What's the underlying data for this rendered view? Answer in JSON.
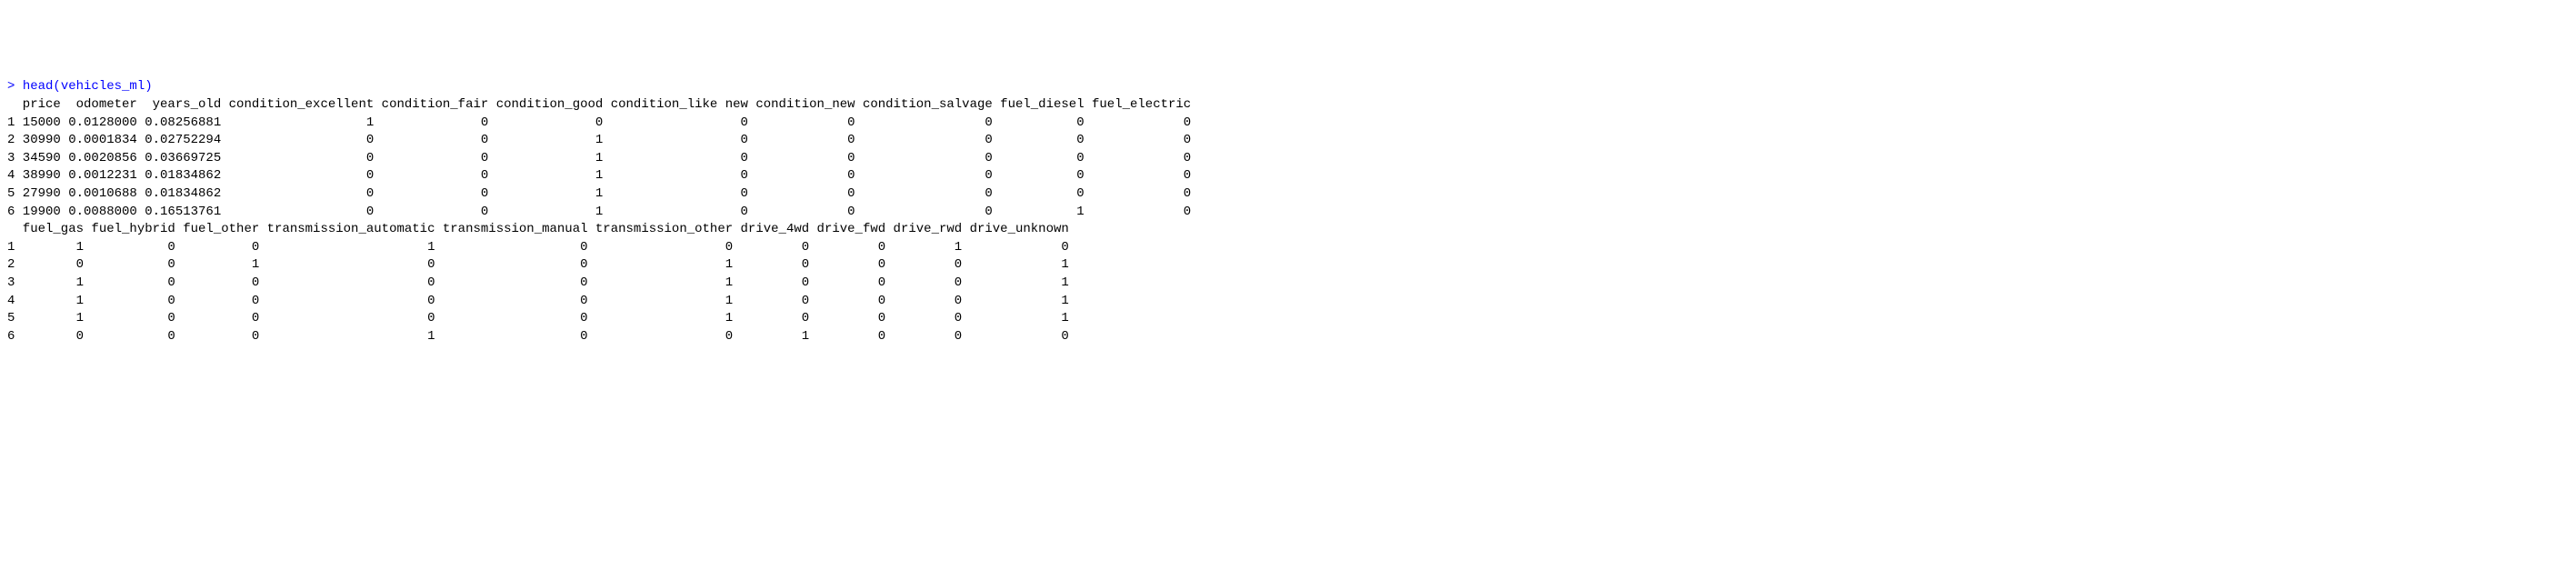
{
  "prompt": "> ",
  "command": "head(vehicles_ml)",
  "table1": {
    "header": "  price  odometer  years_old condition_excellent condition_fair condition_good condition_like new condition_new condition_salvage fuel_diesel fuel_electric",
    "rows": [
      "1 15000 0.0128000 0.08256881                   1              0              0                  0             0                 0           0             0",
      "2 30990 0.0001834 0.02752294                   0              0              1                  0             0                 0           0             0",
      "3 34590 0.0020856 0.03669725                   0              0              1                  0             0                 0           0             0",
      "4 38990 0.0012231 0.01834862                   0              0              1                  0             0                 0           0             0",
      "5 27990 0.0010688 0.01834862                   0              0              1                  0             0                 0           0             0",
      "6 19900 0.0088000 0.16513761                   0              0              1                  0             0                 0           1             0"
    ]
  },
  "table2": {
    "header": "  fuel_gas fuel_hybrid fuel_other transmission_automatic transmission_manual transmission_other drive_4wd drive_fwd drive_rwd drive_unknown",
    "rows": [
      "1        1           0          0                      1                   0                  0         0         0         1             0",
      "2        0           0          1                      0                   0                  1         0         0         0             1",
      "3        1           0          0                      0                   0                  1         0         0         0             1",
      "4        1           0          0                      0                   0                  1         0         0         0             1",
      "5        1           0          0                      0                   0                  1         0         0         0             1",
      "6        0           0          0                      1                   0                  0         1         0         0             0"
    ]
  },
  "chart_data": {
    "type": "table",
    "title": "head(vehicles_ml)",
    "columns_part1": [
      "price",
      "odometer",
      "years_old",
      "condition_excellent",
      "condition_fair",
      "condition_good",
      "condition_like new",
      "condition_new",
      "condition_salvage",
      "fuel_diesel",
      "fuel_electric"
    ],
    "columns_part2": [
      "fuel_gas",
      "fuel_hybrid",
      "fuel_other",
      "transmission_automatic",
      "transmission_manual",
      "transmission_other",
      "drive_4wd",
      "drive_fwd",
      "drive_rwd",
      "drive_unknown"
    ],
    "data": [
      {
        "row": 1,
        "price": 15000,
        "odometer": 0.0128,
        "years_old": 0.08256881,
        "condition_excellent": 1,
        "condition_fair": 0,
        "condition_good": 0,
        "condition_like_new": 0,
        "condition_new": 0,
        "condition_salvage": 0,
        "fuel_diesel": 0,
        "fuel_electric": 0,
        "fuel_gas": 1,
        "fuel_hybrid": 0,
        "fuel_other": 0,
        "transmission_automatic": 1,
        "transmission_manual": 0,
        "transmission_other": 0,
        "drive_4wd": 0,
        "drive_fwd": 0,
        "drive_rwd": 1,
        "drive_unknown": 0
      },
      {
        "row": 2,
        "price": 30990,
        "odometer": 0.0001834,
        "years_old": 0.02752294,
        "condition_excellent": 0,
        "condition_fair": 0,
        "condition_good": 1,
        "condition_like_new": 0,
        "condition_new": 0,
        "condition_salvage": 0,
        "fuel_diesel": 0,
        "fuel_electric": 0,
        "fuel_gas": 0,
        "fuel_hybrid": 0,
        "fuel_other": 1,
        "transmission_automatic": 0,
        "transmission_manual": 0,
        "transmission_other": 1,
        "drive_4wd": 0,
        "drive_fwd": 0,
        "drive_rwd": 0,
        "drive_unknown": 1
      },
      {
        "row": 3,
        "price": 34590,
        "odometer": 0.0020856,
        "years_old": 0.03669725,
        "condition_excellent": 0,
        "condition_fair": 0,
        "condition_good": 1,
        "condition_like_new": 0,
        "condition_new": 0,
        "condition_salvage": 0,
        "fuel_diesel": 0,
        "fuel_electric": 0,
        "fuel_gas": 1,
        "fuel_hybrid": 0,
        "fuel_other": 0,
        "transmission_automatic": 0,
        "transmission_manual": 0,
        "transmission_other": 1,
        "drive_4wd": 0,
        "drive_fwd": 0,
        "drive_rwd": 0,
        "drive_unknown": 1
      },
      {
        "row": 4,
        "price": 38990,
        "odometer": 0.0012231,
        "years_old": 0.01834862,
        "condition_excellent": 0,
        "condition_fair": 0,
        "condition_good": 1,
        "condition_like_new": 0,
        "condition_new": 0,
        "condition_salvage": 0,
        "fuel_diesel": 0,
        "fuel_electric": 0,
        "fuel_gas": 1,
        "fuel_hybrid": 0,
        "fuel_other": 0,
        "transmission_automatic": 0,
        "transmission_manual": 0,
        "transmission_other": 1,
        "drive_4wd": 0,
        "drive_fwd": 0,
        "drive_rwd": 0,
        "drive_unknown": 1
      },
      {
        "row": 5,
        "price": 27990,
        "odometer": 0.0010688,
        "years_old": 0.01834862,
        "condition_excellent": 0,
        "condition_fair": 0,
        "condition_good": 1,
        "condition_like_new": 0,
        "condition_new": 0,
        "condition_salvage": 0,
        "fuel_diesel": 0,
        "fuel_electric": 0,
        "fuel_gas": 1,
        "fuel_hybrid": 0,
        "fuel_other": 0,
        "transmission_automatic": 0,
        "transmission_manual": 0,
        "transmission_other": 1,
        "drive_4wd": 0,
        "drive_fwd": 0,
        "drive_rwd": 0,
        "drive_unknown": 1
      },
      {
        "row": 6,
        "price": 19900,
        "odometer": 0.0088,
        "years_old": 0.16513761,
        "condition_excellent": 0,
        "condition_fair": 0,
        "condition_good": 1,
        "condition_like_new": 0,
        "condition_new": 0,
        "condition_salvage": 0,
        "fuel_diesel": 1,
        "fuel_electric": 0,
        "fuel_gas": 0,
        "fuel_hybrid": 0,
        "fuel_other": 0,
        "transmission_automatic": 1,
        "transmission_manual": 0,
        "transmission_other": 0,
        "drive_4wd": 1,
        "drive_fwd": 0,
        "drive_rwd": 0,
        "drive_unknown": 0
      }
    ]
  }
}
